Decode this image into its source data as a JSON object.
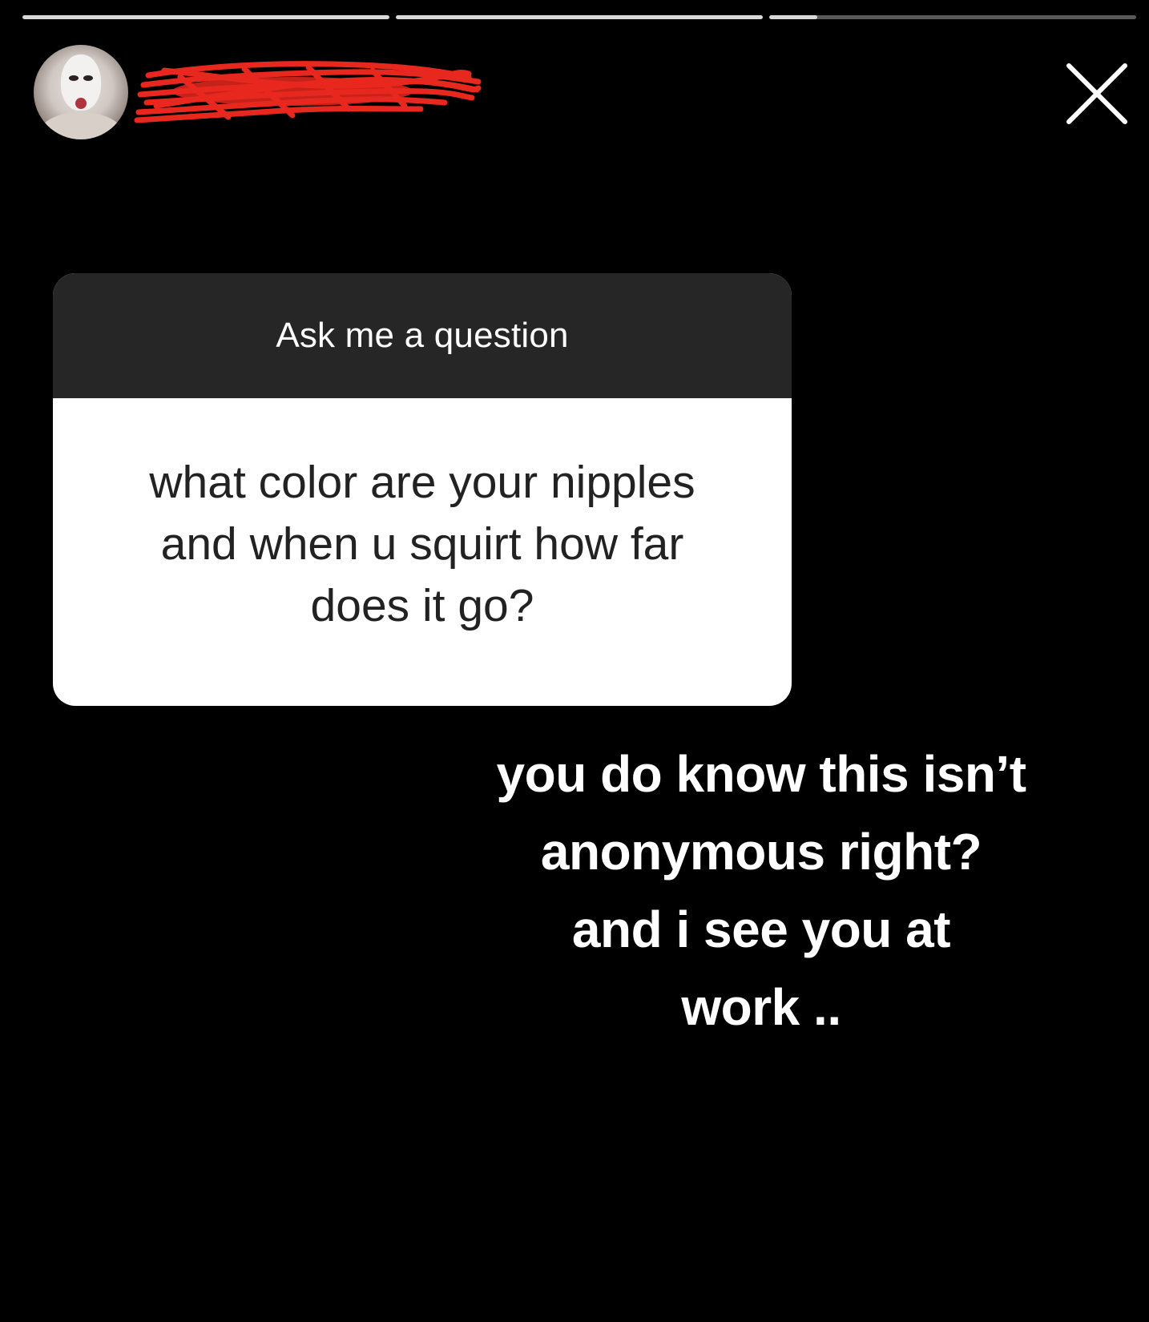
{
  "story": {
    "progress": [
      1.0,
      1.0,
      0.13
    ],
    "close_icon": "close-icon",
    "avatar_icon": "avatar"
  },
  "question_sticker": {
    "header": "Ask me a question",
    "question": "what color are your nipples\nand when u squirt how far\ndoes it go?"
  },
  "reply": {
    "text": "you do know this isn’t\nanonymous right?\nand i see you at\nwork .."
  },
  "colors": {
    "background": "#000000",
    "sticker_header": "#262626",
    "sticker_body": "#ffffff",
    "redaction": "#e8281e"
  }
}
